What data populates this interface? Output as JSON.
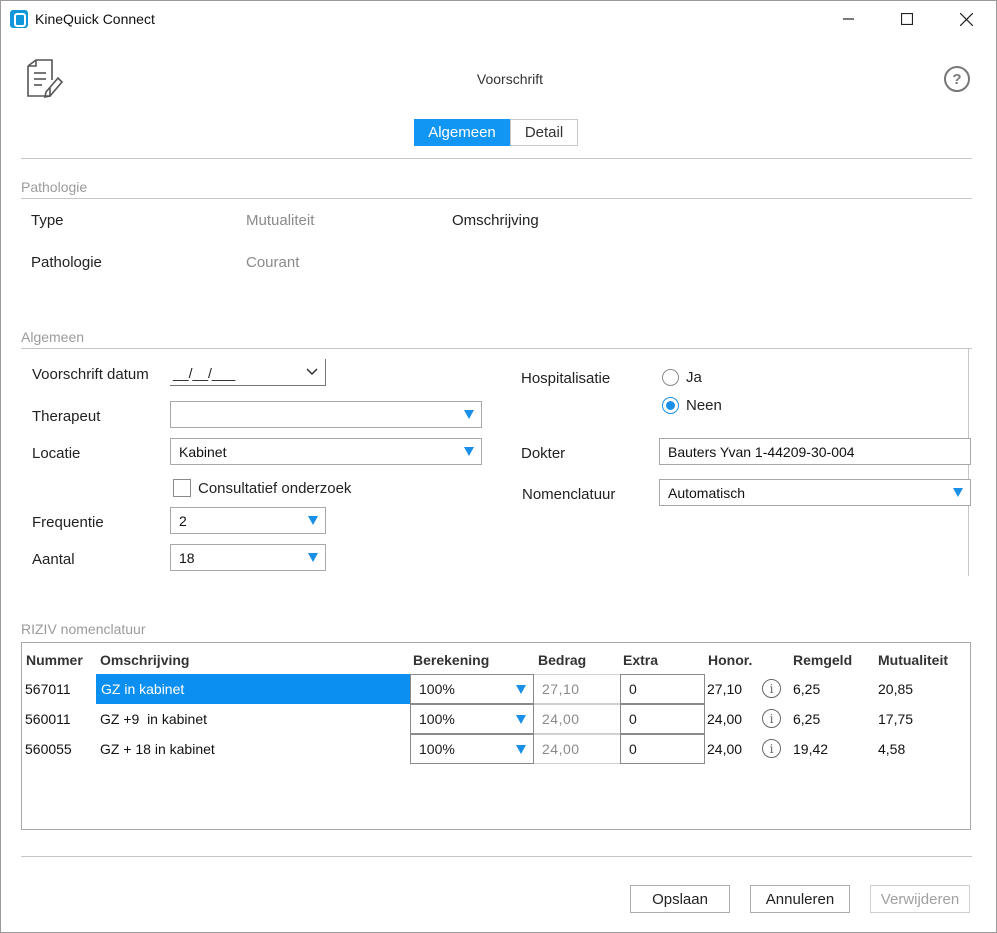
{
  "window": {
    "title": "KineQuick Connect",
    "minimize_icon": "minimize-icon",
    "maximize_icon": "maximize-icon",
    "close_icon": "close-icon"
  },
  "header": {
    "title": "Voorschrift",
    "doc_icon": "prescription-document-icon",
    "help_label": "?"
  },
  "tabs": [
    {
      "label": "Algemeen",
      "active": true
    },
    {
      "label": "Detail",
      "active": false
    }
  ],
  "pathologie_section": {
    "title": "Pathologie",
    "type_label": "Type",
    "type_value": "Mutualiteit",
    "omschrijving_label": "Omschrijving",
    "pathologie_label": "Pathologie",
    "pathologie_value": "Courant"
  },
  "algemeen_section": {
    "title": "Algemeen",
    "voorschrift_datum": {
      "label": "Voorschrift datum",
      "value": "__/__/___"
    },
    "therapeut": {
      "label": "Therapeut",
      "value": ""
    },
    "locatie": {
      "label": "Locatie",
      "value": "Kabinet"
    },
    "consultatief": {
      "label": "Consultatief onderzoek",
      "checked": false
    },
    "frequentie": {
      "label": "Frequentie",
      "value": "2"
    },
    "aantal": {
      "label": "Aantal",
      "value": "18"
    },
    "hospitalisatie": {
      "label": "Hospitalisatie",
      "options": [
        {
          "label": "Ja",
          "checked": false
        },
        {
          "label": "Neen",
          "checked": true
        }
      ]
    },
    "dokter": {
      "label": "Dokter",
      "value": "Bauters Yvan 1-44209-30-004"
    },
    "nomenclatuur": {
      "label": "Nomenclatuur",
      "value": "Automatisch"
    }
  },
  "riziv": {
    "title": "RIZIV nomenclatuur",
    "columns": [
      "Nummer",
      "Omschrijving",
      "Berekening",
      "Bedrag",
      "Extra",
      "Honor.",
      "Remgeld",
      "Mutualiteit"
    ],
    "rows": [
      {
        "nummer": "567011",
        "omschrijving": "GZ in kabinet",
        "berekening": "100%",
        "bedrag": "27,10",
        "extra": "0",
        "honor": "27,10",
        "remgeld": "6,25",
        "mutualiteit": "20,85",
        "selected": true
      },
      {
        "nummer": "560011",
        "omschrijving": "GZ +9  in kabinet",
        "berekening": "100%",
        "bedrag": "24,00",
        "extra": "0",
        "honor": "24,00",
        "remgeld": "6,25",
        "mutualiteit": "17,75",
        "selected": false
      },
      {
        "nummer": "560055",
        "omschrijving": "GZ + 18 in kabinet",
        "berekening": "100%",
        "bedrag": "24,00",
        "extra": "0",
        "honor": "24,00",
        "remgeld": "19,42",
        "mutualiteit": "4,58",
        "selected": false
      }
    ],
    "info_icon": "info-icon"
  },
  "footer": {
    "save_label": "Opslaan",
    "cancel_label": "Annuleren",
    "delete_label": "Verwijderen"
  },
  "colors": {
    "accent": "#1296f3",
    "selection": "#0b8ff0",
    "section_title": "#9b9b9b"
  }
}
